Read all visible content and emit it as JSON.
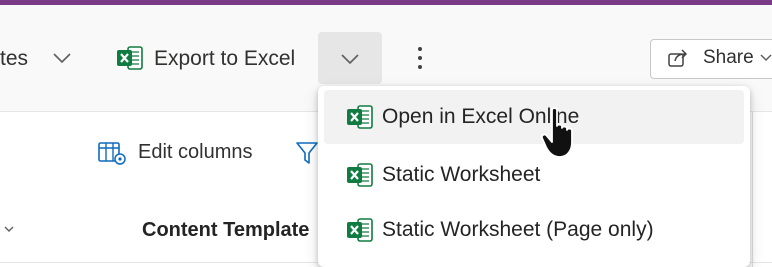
{
  "toolbar": {
    "partial_label": "tes",
    "export_label": "Export to Excel",
    "share_label": "Share"
  },
  "content": {
    "edit_columns_label": "Edit columns",
    "column_header": "Content Template"
  },
  "export_menu": {
    "items": [
      {
        "label": "Open in Excel Online",
        "icon": "excel-icon",
        "hovered": true
      },
      {
        "label": "Static Worksheet",
        "icon": "excel-icon",
        "hovered": false
      },
      {
        "label": "Static Worksheet (Page only)",
        "icon": "excel-icon",
        "hovered": false
      }
    ]
  },
  "colors": {
    "accent_bar": "#7a3b86",
    "excel_green": "#107c41",
    "link_blue": "#0f6cbd"
  }
}
